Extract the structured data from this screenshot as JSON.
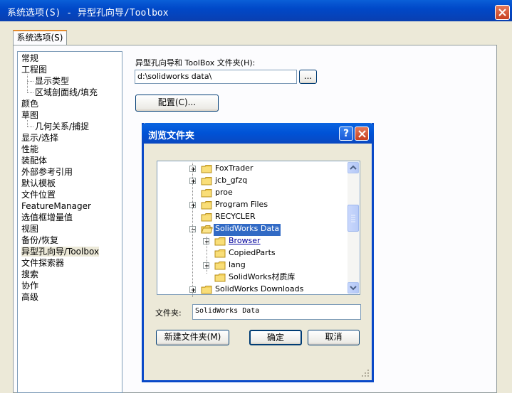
{
  "window": {
    "title": "系统选项(S) - 异型孔向导/Toolbox"
  },
  "tabs": [
    {
      "label": "系统选项(S)",
      "active": true
    }
  ],
  "nav": {
    "items": [
      {
        "label": "常规",
        "level": 0
      },
      {
        "label": "工程图",
        "level": 0
      },
      {
        "label": "显示类型",
        "level": 1
      },
      {
        "label": "区域剖面线/填充",
        "level": 1
      },
      {
        "label": "颜色",
        "level": 0
      },
      {
        "label": "草图",
        "level": 0
      },
      {
        "label": "几何关系/捕捉",
        "level": 1
      },
      {
        "label": "显示/选择",
        "level": 0
      },
      {
        "label": "性能",
        "level": 0
      },
      {
        "label": "装配体",
        "level": 0
      },
      {
        "label": "外部参考引用",
        "level": 0
      },
      {
        "label": "默认模板",
        "level": 0
      },
      {
        "label": "文件位置",
        "level": 0
      },
      {
        "label": "FeatureManager",
        "level": 0
      },
      {
        "label": "选值框增量值",
        "level": 0
      },
      {
        "label": "视图",
        "level": 0
      },
      {
        "label": "备份/恢复",
        "level": 0
      },
      {
        "label": "异型孔向导/Toolbox",
        "level": 0,
        "selected": true
      },
      {
        "label": "文件探索器",
        "level": 0
      },
      {
        "label": "搜索",
        "level": 0
      },
      {
        "label": "协作",
        "level": 0
      },
      {
        "label": "高级",
        "level": 0
      }
    ]
  },
  "content": {
    "folder_label": "异型孔向导和 ToolBox 文件夹(H):",
    "folder_path": "d:\\solidworks data\\",
    "browse_label": "...",
    "configure_label": "配置(C)..."
  },
  "dialog": {
    "title": "浏览文件夹",
    "help_label": "?",
    "tree": [
      {
        "label": "FoxTrader",
        "level": 0,
        "expander": "plus"
      },
      {
        "label": "jcb_gfzq",
        "level": 0,
        "expander": "plus"
      },
      {
        "label": "proe",
        "level": 0,
        "expander": "none"
      },
      {
        "label": "Program Files",
        "level": 0,
        "expander": "plus"
      },
      {
        "label": "RECYCLER",
        "level": 0,
        "expander": "none"
      },
      {
        "label": "SolidWorks Data",
        "level": 0,
        "expander": "minus",
        "selected": true,
        "open": true
      },
      {
        "label": "Browser",
        "level": 1,
        "expander": "plus",
        "link": true
      },
      {
        "label": "CopiedParts",
        "level": 1,
        "expander": "none"
      },
      {
        "label": "lang",
        "level": 1,
        "expander": "plus"
      },
      {
        "label": "SolidWorks材质库",
        "level": 1,
        "expander": "none"
      },
      {
        "label": "SolidWorks Downloads",
        "level": 0,
        "expander": "plus"
      }
    ],
    "folder_field_label": "文件夹:",
    "folder_field_value": "SolidWorks Data",
    "new_folder_label": "新建文件夹(M)",
    "ok_label": "确定",
    "cancel_label": "取消"
  },
  "colors": {
    "titlebar": "#0A4FCF",
    "selection": "#316AC5",
    "folder": "#F2D05C"
  }
}
